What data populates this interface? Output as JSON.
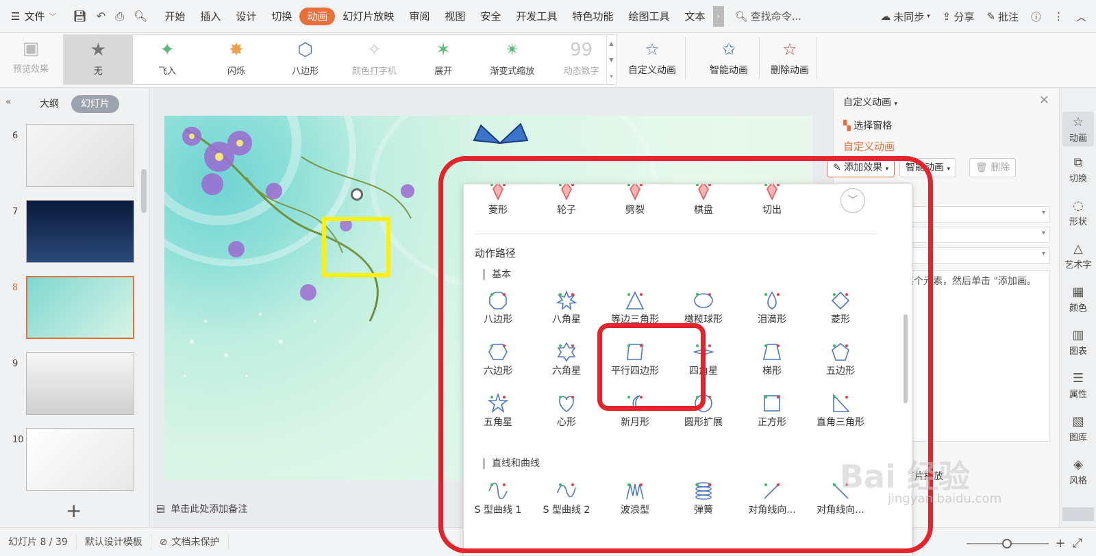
{
  "menubar": {
    "file_label": "文件",
    "tabs": [
      "开始",
      "插入",
      "设计",
      "切换",
      "动画",
      "幻灯片放映",
      "审阅",
      "视图",
      "安全",
      "开发工具",
      "特色功能",
      "绘图工具",
      "文本"
    ],
    "active_tab": "动画",
    "search_label": "查找命令...",
    "sync_label": "未同步",
    "share_label": "分享",
    "comment_label": "批注"
  },
  "ribbon": {
    "preview_label": "预览效果",
    "gallery": [
      {
        "label": "无",
        "icon": "star-icon",
        "state": "selected"
      },
      {
        "label": "飞入",
        "icon": "fly-in-star-icon",
        "state": "normal"
      },
      {
        "label": "闪烁",
        "icon": "flash-star-icon",
        "state": "normal"
      },
      {
        "label": "八边形",
        "icon": "octagon-icon",
        "state": "normal"
      },
      {
        "label": "颜色打字机",
        "icon": "typewriter-star-icon",
        "state": "disabled"
      },
      {
        "label": "展开",
        "icon": "expand-star-icon",
        "state": "normal"
      },
      {
        "label": "渐变式缩放",
        "icon": "zoom-star-icon",
        "state": "normal"
      },
      {
        "label": "动态数字",
        "icon": "number-icon",
        "state": "disabled"
      }
    ],
    "custom_anim_label": "自定义动画",
    "smart_anim_label": "智能动画",
    "delete_anim_label": "删除动画"
  },
  "left_panel": {
    "tab_outline": "大纲",
    "tab_slides": "幻灯片",
    "slides": [
      {
        "num": "6"
      },
      {
        "num": "7"
      },
      {
        "num": "8",
        "active": true
      },
      {
        "num": "9"
      },
      {
        "num": "10"
      }
    ]
  },
  "canvas": {
    "notes_placeholder": "单击此处添加备注"
  },
  "right_pane": {
    "title": "自定义动画",
    "select_pane_label": "选择窗格",
    "section_title": "自定义动画",
    "add_effect_label": "添加效果",
    "smart_anim_label": "智能动画",
    "delete_label": "删除",
    "hint_text": "某个元素，然后单击 \"添加画。",
    "play_label": "幻灯片播放"
  },
  "sidebar": [
    {
      "label": "动画",
      "icon": "animation-icon",
      "active": true
    },
    {
      "label": "切换",
      "icon": "transition-icon"
    },
    {
      "label": "形状",
      "icon": "shape-icon"
    },
    {
      "label": "艺术字",
      "icon": "art-text-icon"
    },
    {
      "label": "颜色",
      "icon": "color-icon"
    },
    {
      "label": "图表",
      "icon": "chart-icon"
    },
    {
      "label": "属性",
      "icon": "property-icon"
    },
    {
      "label": "图库",
      "icon": "gallery-icon"
    },
    {
      "label": "风格",
      "icon": "style-icon"
    }
  ],
  "statusbar": {
    "slide_pos": "幻灯片 8 / 39",
    "template": "默认设计模板",
    "protect": "文档未保护"
  },
  "dropdown": {
    "top_row": [
      "菱形",
      "轮子",
      "劈裂",
      "棋盘",
      "切出"
    ],
    "section_title": "动作路径",
    "basic_title": "基本",
    "basic": [
      [
        "八边形",
        "八角星",
        "等边三角形",
        "橄榄球形",
        "泪滴形",
        "菱形"
      ],
      [
        "六边形",
        "六角星",
        "平行四边形",
        "四角星",
        "梯形",
        "五边形"
      ],
      [
        "五角星",
        "心形",
        "新月形",
        "圆形扩展",
        "正方形",
        "直角三角形"
      ]
    ],
    "lines_title": "直线和曲线",
    "lines": [
      "S 型曲线 1",
      "S 型曲线 2",
      "波浪型",
      "弹簧",
      "对角线向...",
      "对角线向..."
    ]
  },
  "watermark": {
    "brand": "Bai 经验",
    "url": "jingyan.baidu.com"
  },
  "colors": {
    "accent": "#e8703a",
    "annotation": "#e3242b",
    "path_stroke": "#4a78c8"
  }
}
